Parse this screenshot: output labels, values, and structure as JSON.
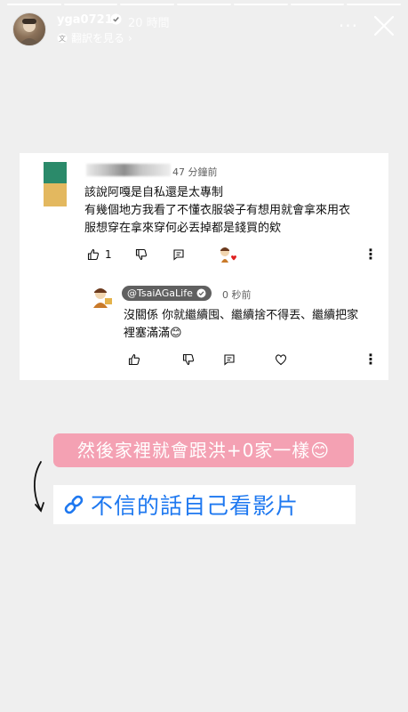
{
  "story": {
    "progress_segments": 7,
    "progress_active_index": 0
  },
  "header": {
    "username": "yga0721",
    "time_ago": "20 時間",
    "translate_label": "翻訳を見る",
    "translate_chevron": "›",
    "more_label": "···"
  },
  "comment": {
    "age": "47 分鐘前",
    "lines": [
      "該說阿嘎是自私還是太專制",
      "有幾個地方我看了不懂衣服袋子有想用就會拿來用衣",
      "服想穿在拿來穿何必丟掉都是錢買的欸"
    ],
    "like_count": "1"
  },
  "reply": {
    "channel": "@TsaiAGaLife",
    "age": "0 秒前",
    "lines": [
      "沒關係 你就繼續囤、繼續捨不得丟、繼續把家",
      "裡塞滿滿😊"
    ]
  },
  "stickers": {
    "caption": "然後家裡就會跟洪+0家一樣😊",
    "link_text": "不信的話自己看影片"
  },
  "colors": {
    "background": "#efefef",
    "caption_bg": "#f4a1b3",
    "link_blue": "#1e78f0",
    "channel_chip": "#606060"
  },
  "icons": [
    "verified-icon",
    "translate-icon",
    "close-icon",
    "thumbs-up-icon",
    "thumbs-down-icon",
    "reply-icon",
    "heart-icon",
    "more-vert-icon",
    "link-icon"
  ]
}
